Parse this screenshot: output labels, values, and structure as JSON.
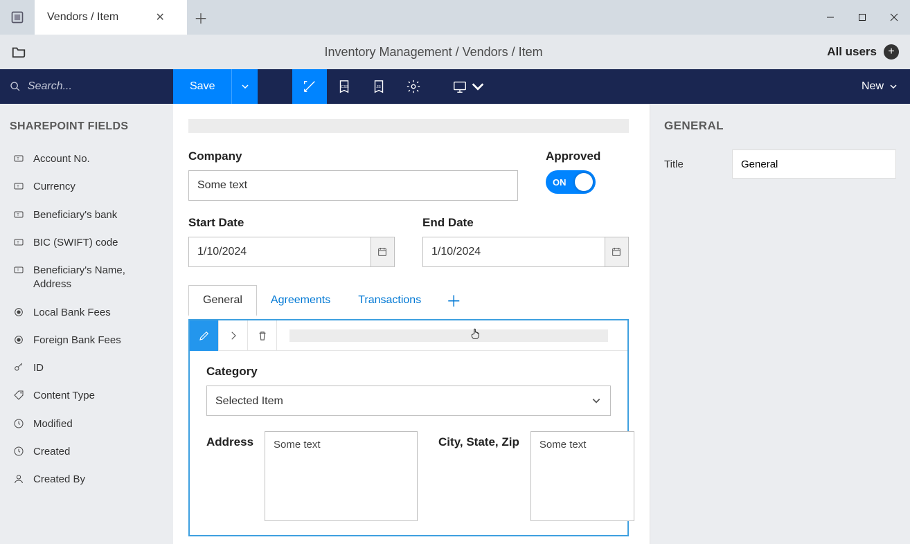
{
  "titlebar": {
    "tab_title": "Vendors / Item"
  },
  "breadcrumb": {
    "text": "Inventory Management / Vendors / Item",
    "allusers": "All users"
  },
  "toolbar": {
    "search_placeholder": "Search...",
    "save": "Save",
    "new": "New"
  },
  "sidebar": {
    "title": "SHAREPOINT FIELDS",
    "items": [
      {
        "icon": "text",
        "label": "Account No."
      },
      {
        "icon": "text",
        "label": "Currency"
      },
      {
        "icon": "text",
        "label": "Beneficiary's bank"
      },
      {
        "icon": "text",
        "label": "BIC (SWIFT) code"
      },
      {
        "icon": "text",
        "label": "Beneficiary's Name, Address"
      },
      {
        "icon": "radio",
        "label": "Local Bank Fees"
      },
      {
        "icon": "radio",
        "label": "Foreign Bank Fees"
      },
      {
        "icon": "key",
        "label": "ID"
      },
      {
        "icon": "tag",
        "label": "Content Type"
      },
      {
        "icon": "clock",
        "label": "Modified"
      },
      {
        "icon": "clock",
        "label": "Created"
      },
      {
        "icon": "user",
        "label": "Created By"
      }
    ]
  },
  "form": {
    "company_label": "Company",
    "company_value": "Some text",
    "approved_label": "Approved",
    "approved_on": "ON",
    "start_label": "Start Date",
    "start_value": "1/10/2024",
    "end_label": "End Date",
    "end_value": "1/10/2024",
    "tabs": [
      "General",
      "Agreements",
      "Transactions"
    ],
    "category_label": "Category",
    "category_value": "Selected Item",
    "address_label": "Address",
    "address_value": "Some text",
    "csz_label": "City, State, Zip",
    "csz_value": "Some text"
  },
  "rightpane": {
    "title": "GENERAL",
    "title_label": "Title",
    "title_value": "General"
  }
}
